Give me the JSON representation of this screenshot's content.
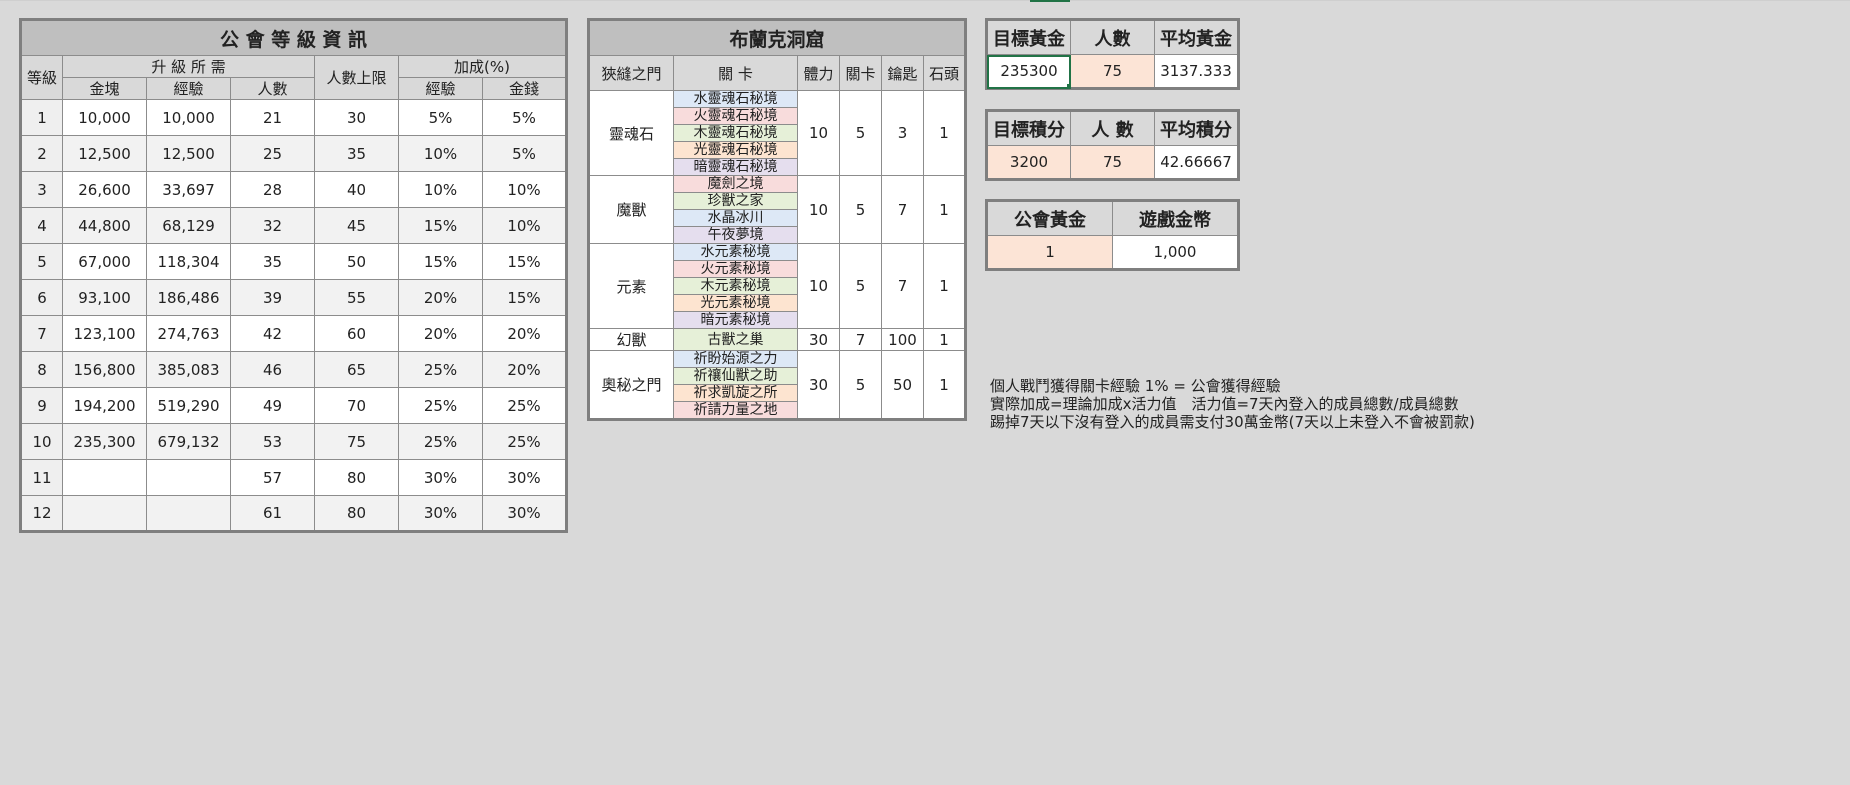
{
  "guild_table": {
    "title": "公 會 等 級 資 訊",
    "h_level": "等級",
    "h_requirements": "升 級 所 需",
    "h_gold": "金塊",
    "h_exp": "經驗",
    "h_members": "人數",
    "h_max_members": "人數上限",
    "h_bonus": "加成(%)",
    "h_bonus_exp": "經驗",
    "h_bonus_money": "金錢",
    "rows": [
      [
        "1",
        "10,000",
        "10,000",
        "21",
        "30",
        "5%",
        "5%"
      ],
      [
        "2",
        "12,500",
        "12,500",
        "25",
        "35",
        "10%",
        "5%"
      ],
      [
        "3",
        "26,600",
        "33,697",
        "28",
        "40",
        "10%",
        "10%"
      ],
      [
        "4",
        "44,800",
        "68,129",
        "32",
        "45",
        "15%",
        "10%"
      ],
      [
        "5",
        "67,000",
        "118,304",
        "35",
        "50",
        "15%",
        "15%"
      ],
      [
        "6",
        "93,100",
        "186,486",
        "39",
        "55",
        "20%",
        "15%"
      ],
      [
        "7",
        "123,100",
        "274,763",
        "42",
        "60",
        "20%",
        "20%"
      ],
      [
        "8",
        "156,800",
        "385,083",
        "46",
        "65",
        "25%",
        "20%"
      ],
      [
        "9",
        "194,200",
        "519,290",
        "49",
        "70",
        "25%",
        "25%"
      ],
      [
        "10",
        "235,300",
        "679,132",
        "53",
        "75",
        "25%",
        "25%"
      ],
      [
        "11",
        "",
        "",
        "57",
        "80",
        "30%",
        "30%"
      ],
      [
        "12",
        "",
        "",
        "61",
        "80",
        "30%",
        "30%"
      ]
    ]
  },
  "cave_table": {
    "title": "布蘭克洞窟",
    "h_gate": "狹縫之門",
    "h_stage": "關 卡",
    "h_stamina": "體力",
    "h_stages": "關卡",
    "h_key": "鑰匙",
    "h_stone": "石頭",
    "groups": [
      {
        "name": "靈魂石",
        "stamina": "10",
        "stages": "5",
        "key": "3",
        "stone": "1",
        "items": [
          {
            "label": "水靈魂石秘境",
            "color": "c-blue"
          },
          {
            "label": "火靈魂石秘境",
            "color": "c-pink"
          },
          {
            "label": "木靈魂石秘境",
            "color": "c-green"
          },
          {
            "label": "光靈魂石秘境",
            "color": "c-peach"
          },
          {
            "label": "暗靈魂石秘境",
            "color": "c-purple"
          }
        ]
      },
      {
        "name": "魔獸",
        "stamina": "10",
        "stages": "5",
        "key": "7",
        "stone": "1",
        "items": [
          {
            "label": "魔劍之境",
            "color": "c-pink"
          },
          {
            "label": "珍獸之家",
            "color": "c-green"
          },
          {
            "label": "水晶冰川",
            "color": "c-blue"
          },
          {
            "label": "午夜夢境",
            "color": "c-purple"
          }
        ]
      },
      {
        "name": "元素",
        "stamina": "10",
        "stages": "5",
        "key": "7",
        "stone": "1",
        "items": [
          {
            "label": "水元素秘境",
            "color": "c-blue"
          },
          {
            "label": "火元素秘境",
            "color": "c-pink"
          },
          {
            "label": "木元素秘境",
            "color": "c-green"
          },
          {
            "label": "光元素秘境",
            "color": "c-peach"
          },
          {
            "label": "暗元素秘境",
            "color": "c-purple"
          }
        ]
      },
      {
        "name": "幻獸",
        "stamina": "30",
        "stages": "7",
        "key": "100",
        "stone": "1",
        "items": [
          {
            "label": "古獸之巢",
            "color": "c-green"
          }
        ]
      },
      {
        "name": "奧秘之門",
        "stamina": "30",
        "stages": "5",
        "key": "50",
        "stone": "1",
        "items": [
          {
            "label": "祈盼始源之力",
            "color": "c-blue"
          },
          {
            "label": "祈禳仙獸之助",
            "color": "c-green"
          },
          {
            "label": "祈求凱旋之所",
            "color": "c-peach"
          },
          {
            "label": "祈請力量之地",
            "color": "c-pink"
          }
        ]
      }
    ]
  },
  "gold_box": {
    "h1": "目標黃金",
    "h2": "人數",
    "h3": "平均黃金",
    "v1": "235300",
    "v2": "75",
    "v3": "3137.333"
  },
  "points_box": {
    "h1": "目標積分",
    "h2": "人 數",
    "h3": "平均積分",
    "v1": "3200",
    "v2": "75",
    "v3": "42.66667"
  },
  "exchange_box": {
    "h1": "公會黃金",
    "h2": "遊戲金幣",
    "v1": "1",
    "v2": "1,000"
  },
  "notes": [
    "個人戰鬥獲得關卡經驗 1% = 公會獲得經驗",
    "實際加成=理論加成x活力值　活力值=7天內登入的成員總數/成員總數",
    "踢掉7天以下沒有登入的成員需支付30萬金幣(7天以上未登入不會被罰款)"
  ]
}
